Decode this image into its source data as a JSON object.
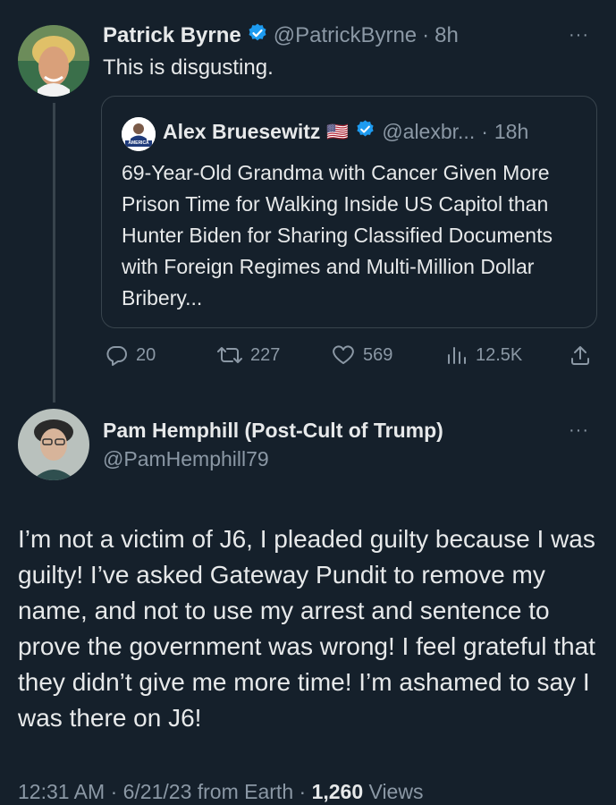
{
  "tweet": {
    "author_name": "Patrick Byrne",
    "author_handle": "@PatrickByrne",
    "time": "8h",
    "text": "This is disgusting.",
    "more": "···"
  },
  "quote": {
    "author_name": "Alex Bruesewitz",
    "flag": "🇺🇸",
    "author_handle": "@alexbr...",
    "time": "18h",
    "avatar_badge": "AMERICA",
    "text": "69-Year-Old Grandma with Cancer Given More Prison Time for Walking Inside US Capitol than Hunter Biden for Sharing Classified Documents with Foreign Regimes and Multi-Million Dollar Bribery..."
  },
  "actions": {
    "replies": "20",
    "retweets": "227",
    "likes": "569",
    "views": "12.5K"
  },
  "reply": {
    "author_name": "Pam Hemphill (Post-Cult of Trump)",
    "author_handle": "@PamHemphill79",
    "more": "···",
    "text": "I’m not a victim of J6, I pleaded guilty because I was guilty! I’ve asked Gateway Pundit to remove my name, and not to use my arrest and sentence to prove the government was wrong! I feel grateful that they didn’t give me more time! I’m ashamed to say I was there on J6!",
    "timestamp": "12:31 AM · 6/21/23 from Earth · ",
    "views_count": "1,260",
    "views_label": "Views"
  },
  "colors": {
    "background": "#15202b",
    "text": "#e7e9ea",
    "muted": "#8b98a5",
    "verified": "#1d9bf0",
    "border": "#38444d"
  },
  "icons": [
    "reply-icon",
    "retweet-icon",
    "like-icon",
    "views-icon",
    "share-icon",
    "verified-icon",
    "more-icon"
  ]
}
